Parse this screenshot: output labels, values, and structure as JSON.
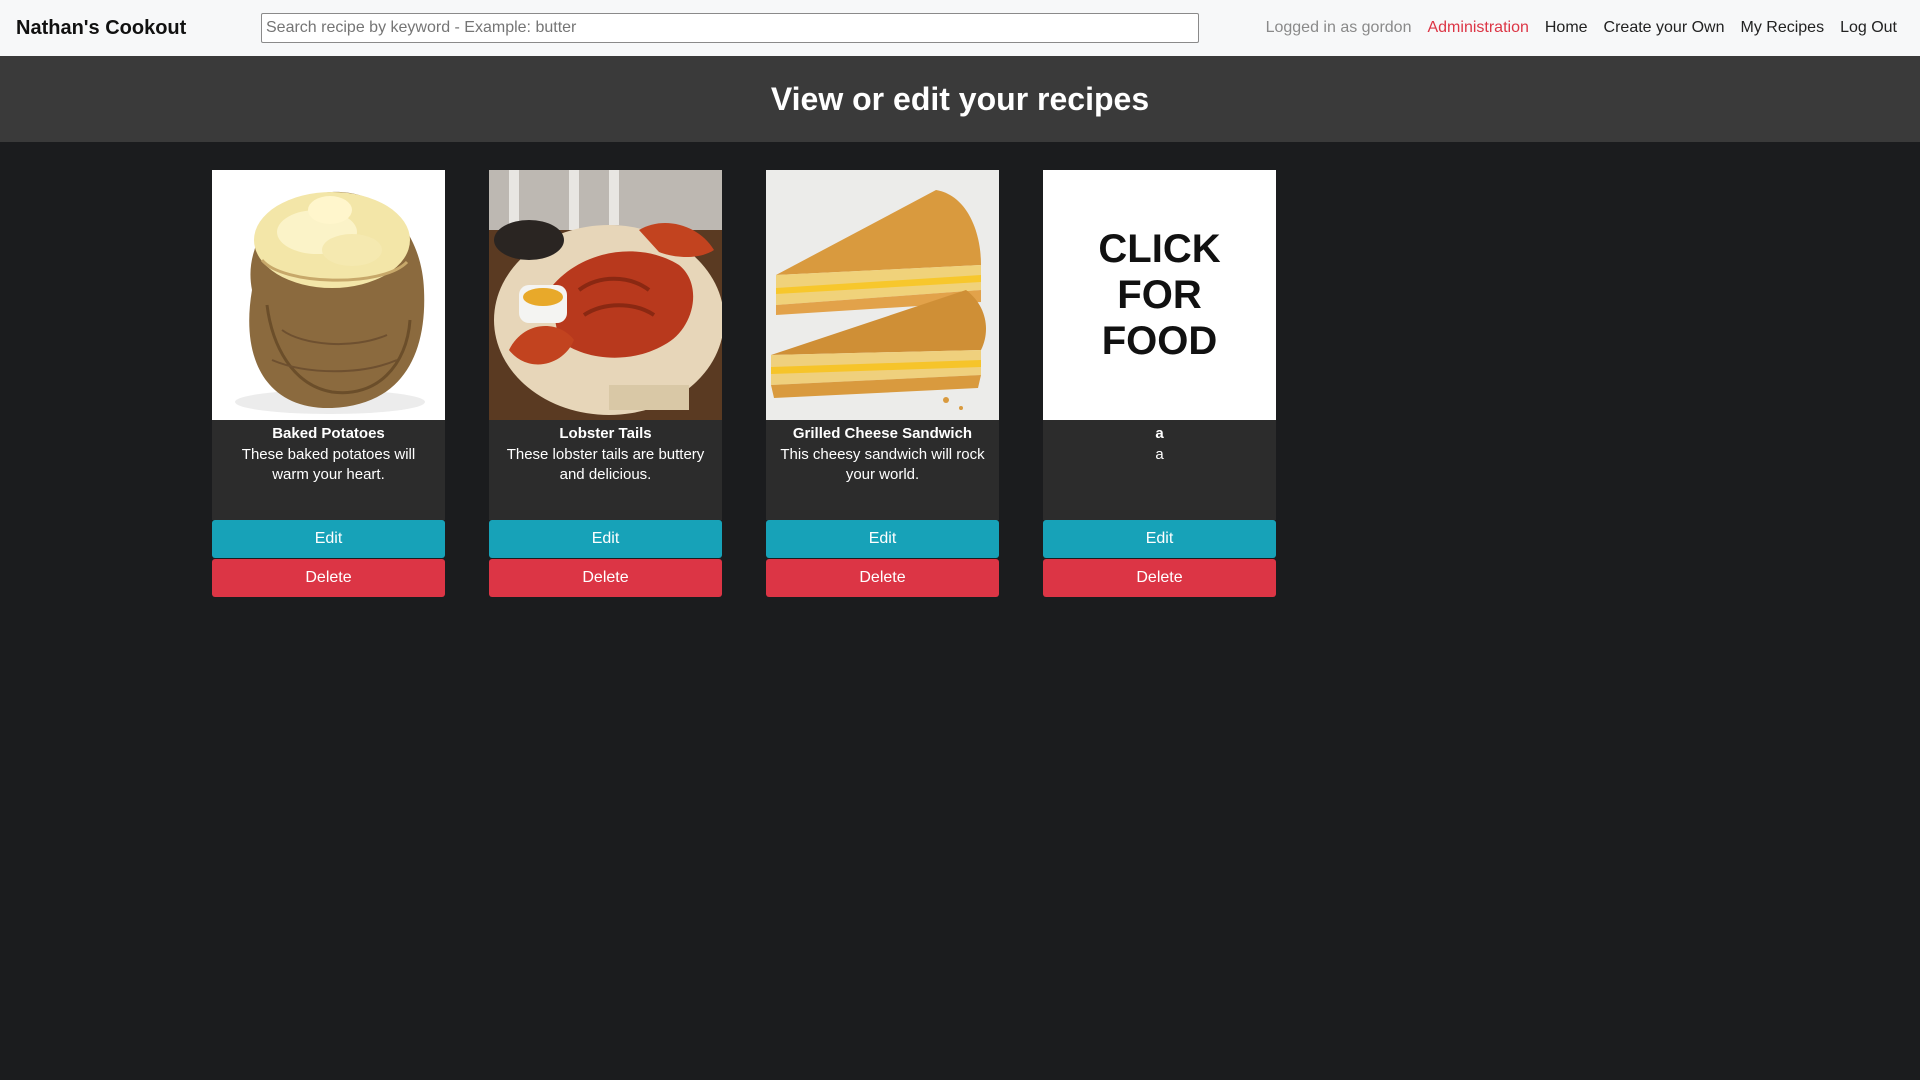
{
  "brand": "Nathan's Cookout",
  "search": {
    "placeholder": "Search recipe by keyword - Example: butter",
    "value": ""
  },
  "nav": {
    "logged_in": "Logged in as gordon",
    "administration": "Administration",
    "home": "Home",
    "create": "Create your Own",
    "my_recipes": "My Recipes",
    "logout": "Log Out"
  },
  "page_title": "View or edit your recipes",
  "recipes": [
    {
      "title": "Baked Potatoes",
      "description": "These baked potatoes will warm your heart.",
      "edit": "Edit",
      "delete": "Delete"
    },
    {
      "title": "Lobster Tails",
      "description": "These lobster tails are buttery and delicious.",
      "edit": "Edit",
      "delete": "Delete"
    },
    {
      "title": "Grilled Cheese Sandwich",
      "description": "This cheesy sandwich will rock your world.",
      "edit": "Edit",
      "delete": "Delete"
    },
    {
      "title": "a",
      "description": "a",
      "edit": "Edit",
      "delete": "Delete",
      "placeholder_image_text": "CLICK FOR FOOD"
    }
  ],
  "colors": {
    "edit": "#17a2b8",
    "delete": "#dc3545",
    "admin_link": "#dc3545",
    "header_band": "#3a3a3a",
    "page_bg": "#1b1c1e",
    "card_body": "#2c2c2c"
  }
}
